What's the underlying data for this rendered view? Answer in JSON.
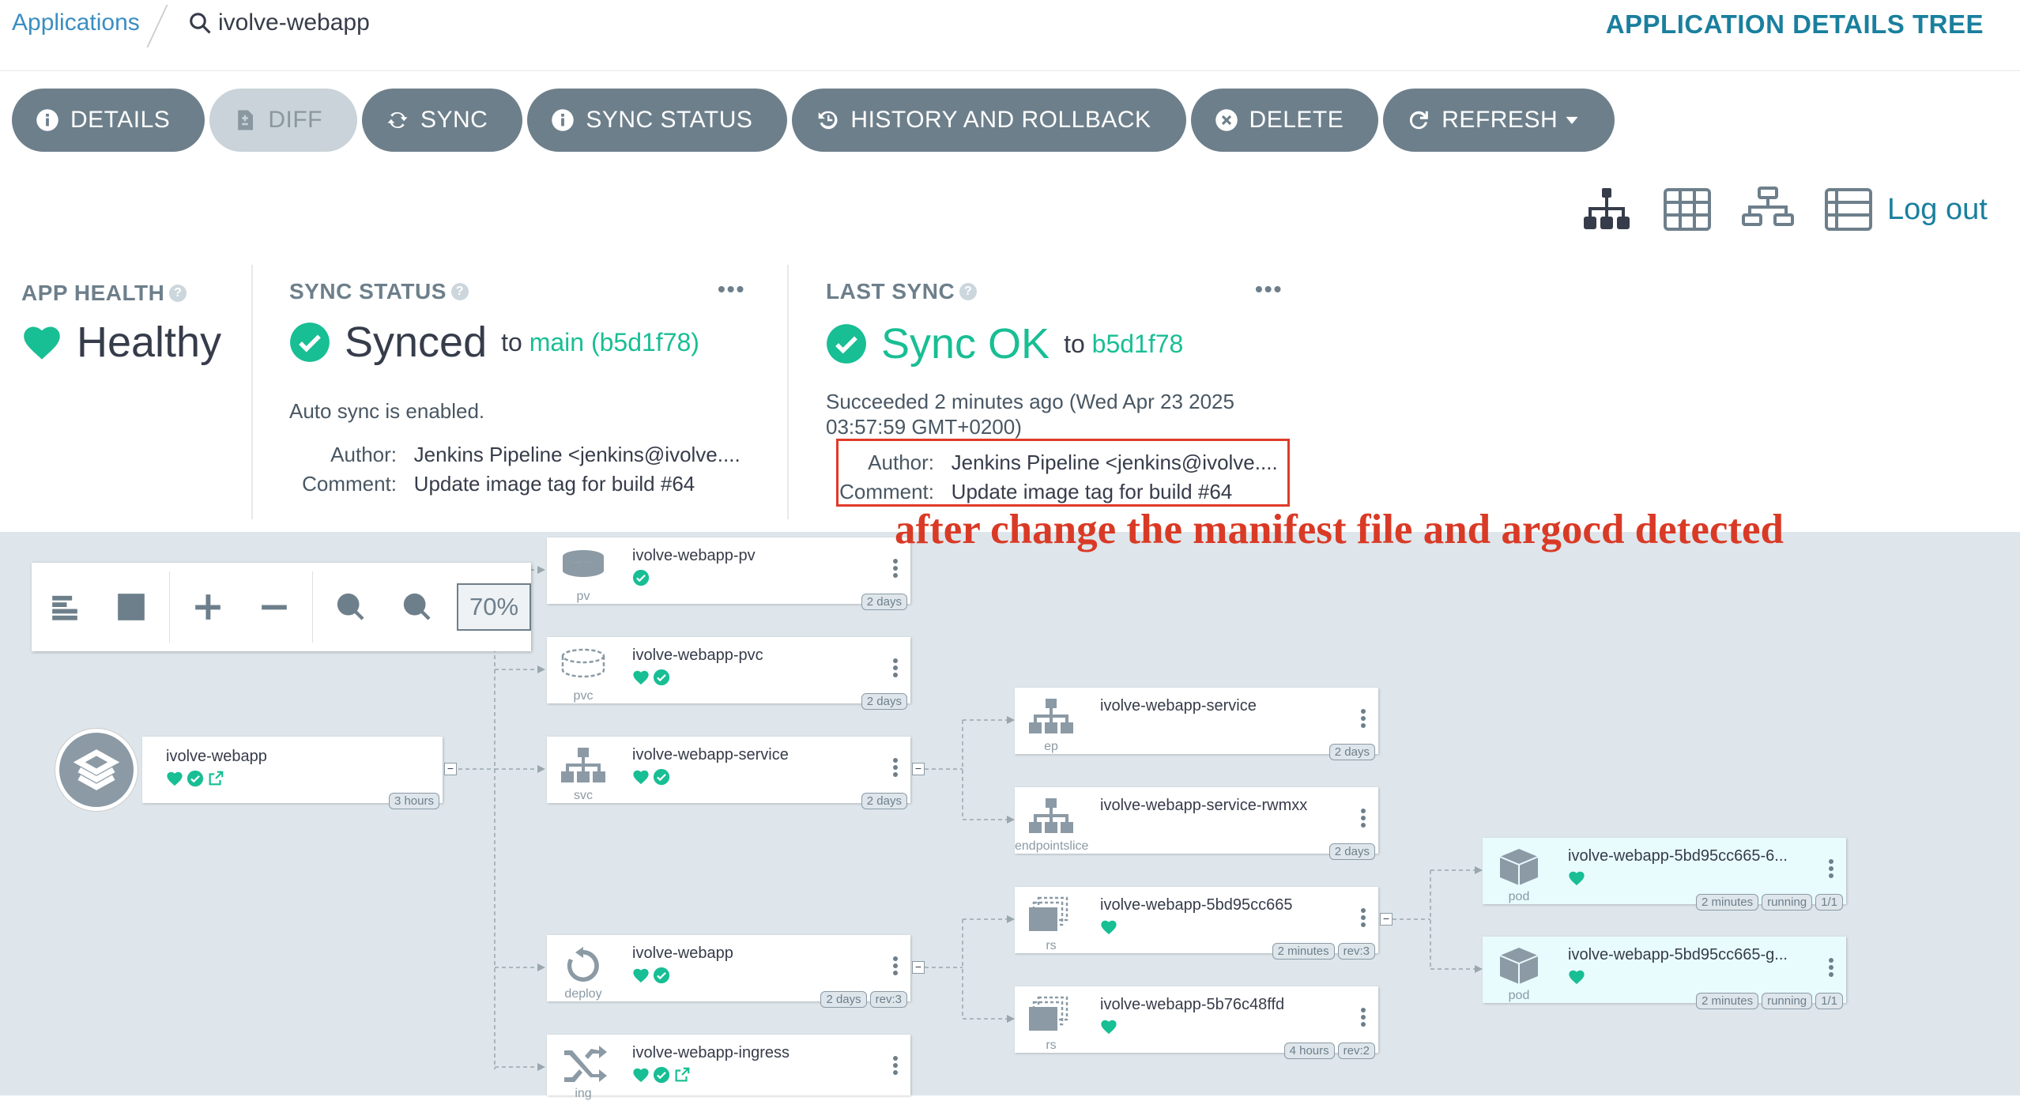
{
  "breadcrumb": {
    "applications": "Applications",
    "app": "ivolve-webapp"
  },
  "page_title": "APPLICATION DETAILS TREE",
  "toolbar": {
    "details": "DETAILS",
    "diff": "DIFF",
    "sync": "SYNC",
    "sync_status": "SYNC STATUS",
    "history": "HISTORY AND ROLLBACK",
    "delete": "DELETE",
    "refresh": "REFRESH"
  },
  "logout": "Log out",
  "app_health": {
    "title": "APP HEALTH",
    "value": "Healthy"
  },
  "sync_status": {
    "title": "SYNC STATUS",
    "value": "Synced",
    "to": "to",
    "branch": "main (b5d1f78)",
    "auto": "Auto sync is enabled.",
    "author_label": "Author:",
    "author": "Jenkins Pipeline <jenkins@ivolve....",
    "comment_label": "Comment:",
    "comment": "Update image tag for build #64",
    "more": "•••"
  },
  "last_sync": {
    "title": "LAST SYNC",
    "value": "Sync OK",
    "to": "to",
    "revision": "b5d1f78",
    "succeeded_line1": "Succeeded 2 minutes ago (Wed Apr 23 2025",
    "succeeded_line2": "03:57:59 GMT+0200)",
    "author_label": "Author:",
    "author": "Jenkins Pipeline <jenkins@ivolve....",
    "comment_label": "Comment:",
    "comment": "Update image tag for build #64",
    "more": "•••"
  },
  "annotation": "after change the manifest file and argocd detected",
  "zoom": {
    "value": "70%"
  },
  "app_node": {
    "name": "ivolve-webapp",
    "age": "3 hours"
  },
  "nodes": [
    {
      "name": "ivolve-webapp-pv",
      "kind": "pv",
      "tags": [
        "2 days"
      ]
    },
    {
      "name": "ivolve-webapp-pvc",
      "kind": "pvc",
      "tags": [
        "2 days"
      ]
    },
    {
      "name": "ivolve-webapp-service",
      "kind": "svc",
      "tags": [
        "2 days"
      ]
    },
    {
      "name": "ivolve-webapp",
      "kind": "deploy",
      "tags": [
        "2 days",
        "rev:3"
      ]
    },
    {
      "name": "ivolve-webapp-ingress",
      "kind": "ing",
      "tags": []
    },
    {
      "name": "ivolve-webapp-service",
      "kind": "ep",
      "tags": [
        "2 days"
      ]
    },
    {
      "name": "ivolve-webapp-service-rwmxx",
      "kind": "endpointslice",
      "tags": [
        "2 days"
      ]
    },
    {
      "name": "ivolve-webapp-5bd95cc665",
      "kind": "rs",
      "tags": [
        "2 minutes",
        "rev:3"
      ]
    },
    {
      "name": "ivolve-webapp-5b76c48ffd",
      "kind": "rs",
      "tags": [
        "4 hours",
        "rev:2"
      ]
    },
    {
      "name": "ivolve-webapp-5bd95cc665-6...",
      "kind": "pod",
      "tags": [
        "2 minutes",
        "running",
        "1/1"
      ]
    },
    {
      "name": "ivolve-webapp-5bd95cc665-g...",
      "kind": "pod",
      "tags": [
        "2 minutes",
        "running",
        "1/1"
      ]
    }
  ],
  "colors": {
    "accent": "#18be94",
    "link": "#1a7f9e",
    "button": "#6d7f8b",
    "annotation": "#d93a26"
  }
}
